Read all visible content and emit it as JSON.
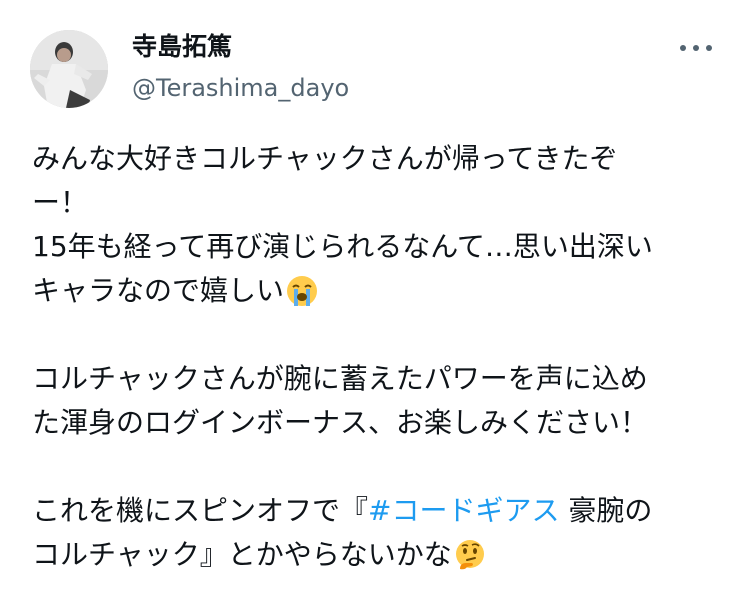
{
  "user": {
    "display_name": "寺島拓篤",
    "handle": "@Terashima_dayo"
  },
  "menu": {
    "icon": "more-horizontal-icon"
  },
  "tweet": {
    "lines": [
      "みんな大好きコルチャックさんが帰ってきたぞ",
      "ー！",
      "15年も経って再び演じられるなんて…思い出深い",
      "キャラなので嬉しい",
      "",
      "コルチャックさんが腕に蓄えたパワーを声に込め",
      "た渾身のログインボーナス、お楽しみください！",
      "",
      "これを機にスピンオフで『",
      "コルチャック』とかやらないかな"
    ],
    "hashtag": "#コードギアス",
    "line9_suffix": " 豪腕の",
    "emoji_crying": "loudly-crying-face-icon",
    "emoji_thinking": "thinking-face-icon"
  },
  "colors": {
    "text": "#0f1419",
    "secondary": "#536471",
    "link": "#1d9bf0"
  }
}
